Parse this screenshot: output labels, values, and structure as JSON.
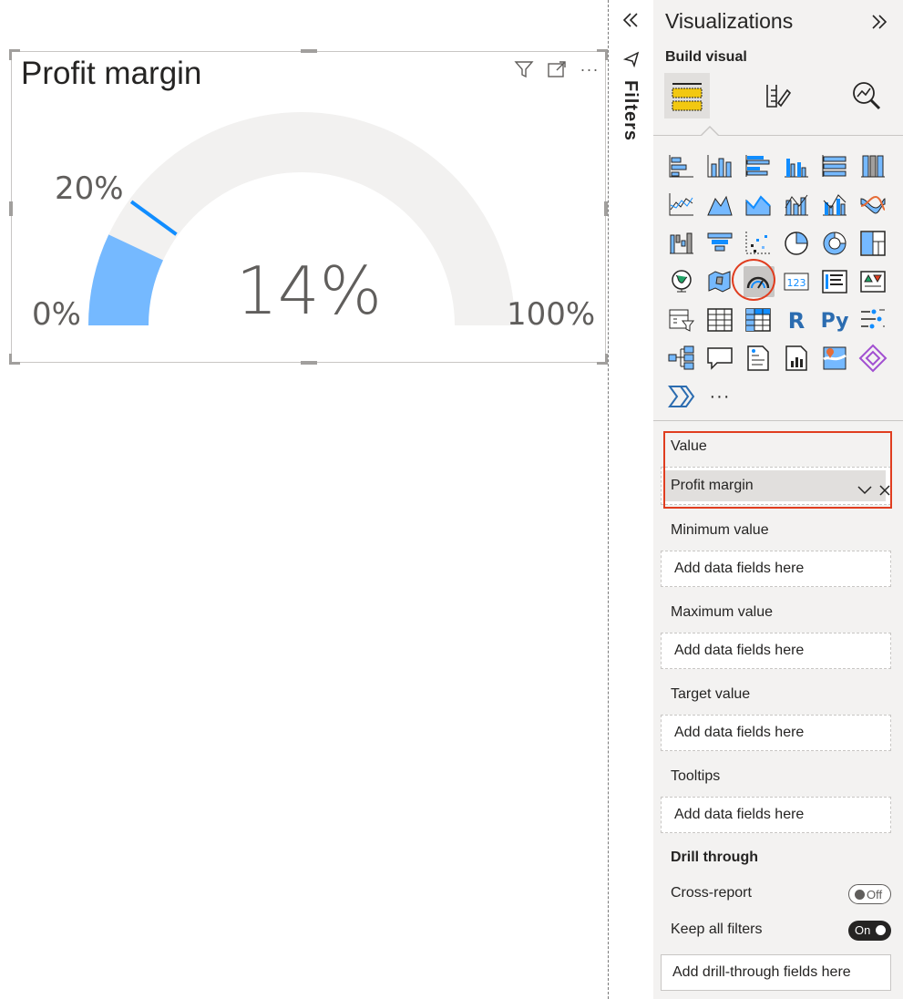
{
  "visual": {
    "title": "Profit margin",
    "header_icons": [
      "filter-icon",
      "focus-mode-icon",
      "more-options-icon"
    ],
    "more_label": "···"
  },
  "gauge": {
    "type": "gauge",
    "value": 14,
    "min": 0,
    "max": 100,
    "target": 20,
    "value_label": "14%",
    "min_label": "0%",
    "max_label": "100%",
    "target_label": "20%",
    "fill_color": "#75b9ff",
    "track_color": "#f2f1f0",
    "target_color": "#118dff"
  },
  "filters_pane": {
    "label": "Filters"
  },
  "viz_pane": {
    "title": "Visualizations",
    "build_visual": "Build visual",
    "tabs": [
      "build-visual-tab",
      "format-visual-tab",
      "analytics-tab"
    ],
    "more_visuals": "···",
    "r_label": "R",
    "py_label": "Py",
    "card_label": "123"
  },
  "wells": {
    "value_label": "Value",
    "value_field": "Profit margin",
    "min_label": "Minimum value",
    "max_label": "Maximum value",
    "target_label": "Target value",
    "tooltips_label": "Tooltips",
    "placeholder": "Add data fields here"
  },
  "drill": {
    "heading": "Drill through",
    "cross_report": "Cross-report",
    "cross_report_state": "Off",
    "keep_filters": "Keep all filters",
    "keep_filters_state": "On",
    "drill_placeholder": "Add drill-through fields here"
  },
  "colors": {
    "accent_red": "#e03d1f",
    "pane_bg": "#f3f2f1"
  }
}
